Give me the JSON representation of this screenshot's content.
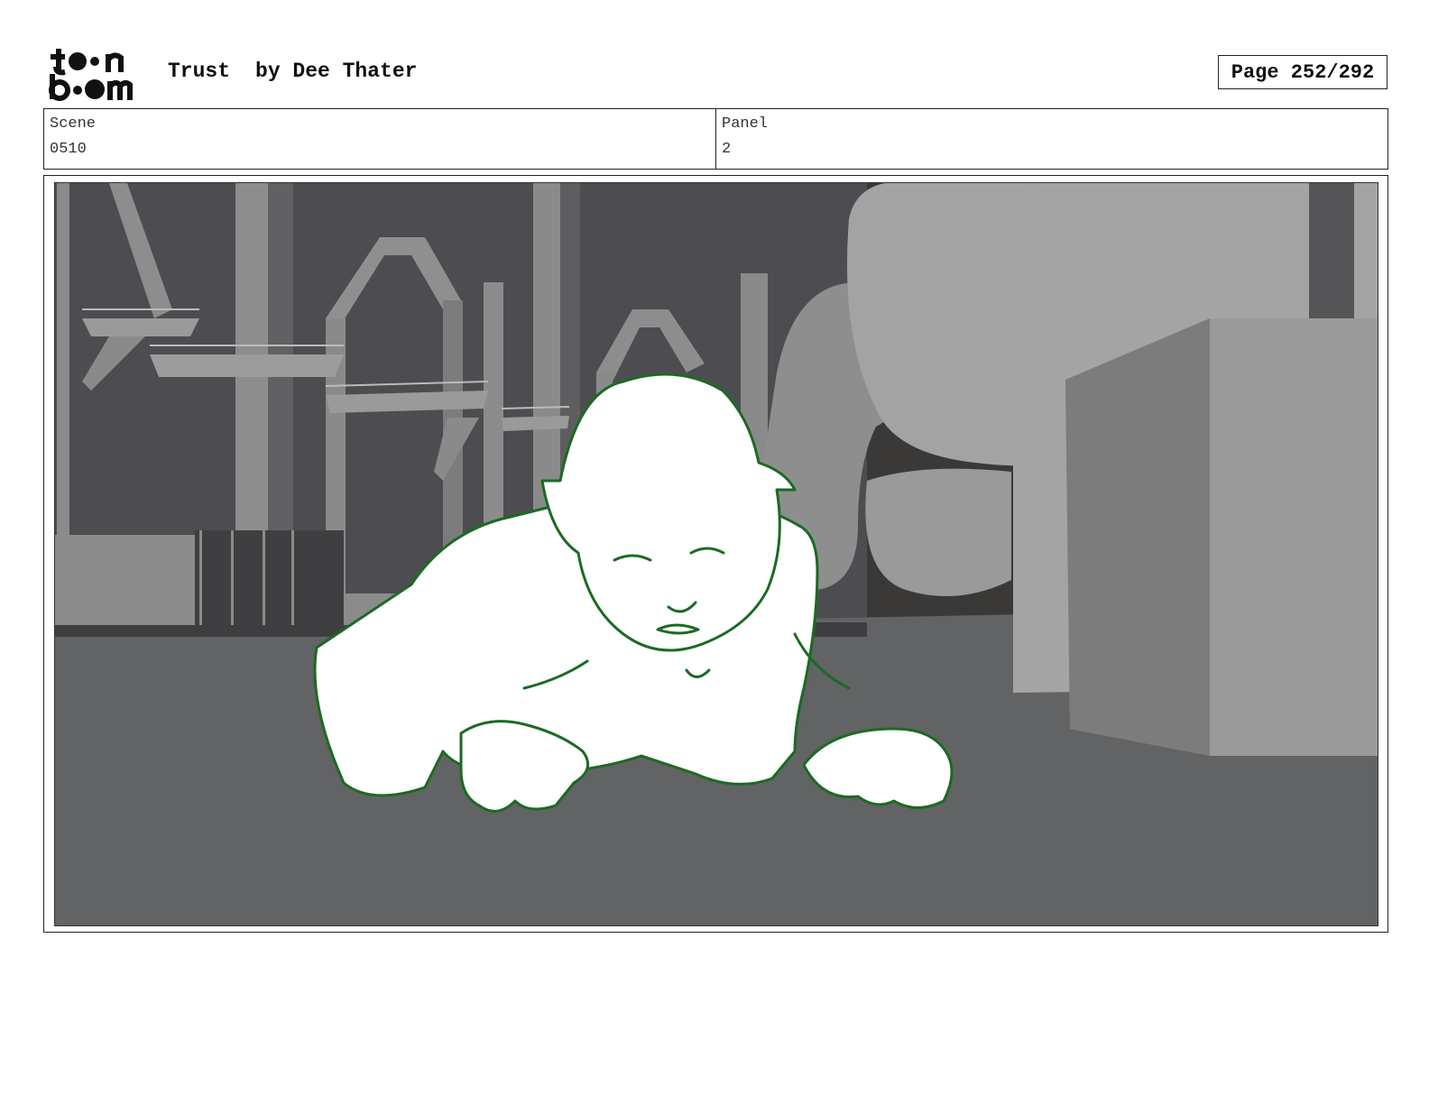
{
  "header": {
    "logo_text_top": "toon",
    "logo_text_bottom": "boom",
    "title": "Trust",
    "author": "by Dee Thater",
    "page_indicator": "Page 252/292"
  },
  "info": {
    "scene_label": "Scene",
    "scene_value": "0510",
    "panel_label": "Panel",
    "panel_value": "2"
  },
  "panel": {
    "image_name": "storyboard-panel-sketch",
    "colors": {
      "sky": "#3a3a3a",
      "floor": "#626364",
      "wall": "#4c4c50",
      "sketch_line": "#1a6b22",
      "sketch_fill": "#ffffff"
    }
  }
}
